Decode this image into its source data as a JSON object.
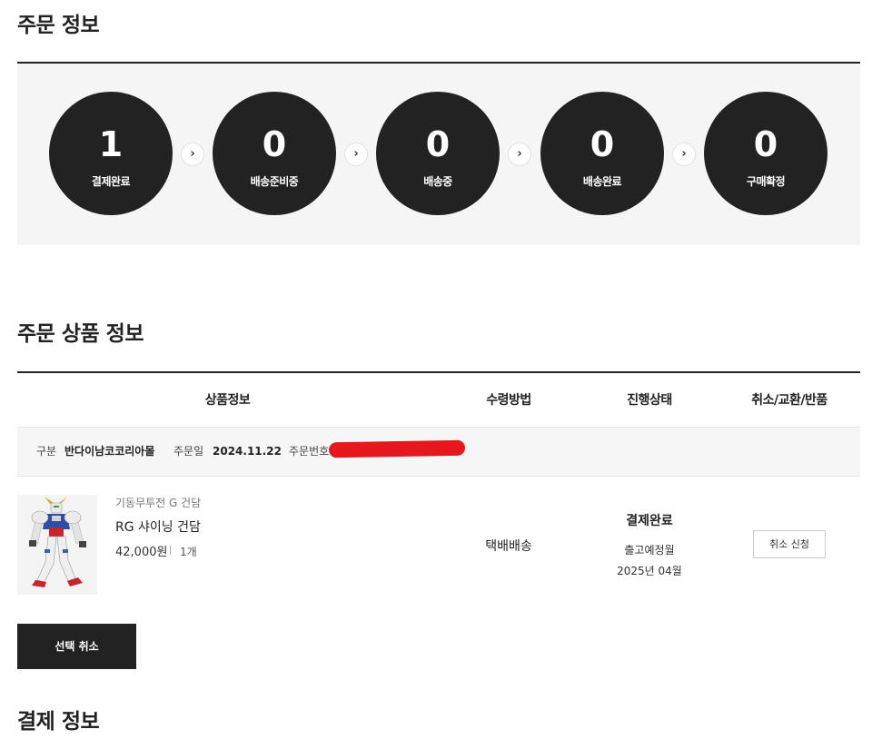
{
  "sections": {
    "order_info_title": "주문 정보",
    "order_items_title": "주문 상품 정보",
    "payment_info_title": "결제 정보"
  },
  "order_status": [
    {
      "count": "1",
      "label": "결제완료"
    },
    {
      "count": "0",
      "label": "배송준비중"
    },
    {
      "count": "0",
      "label": "배송중"
    },
    {
      "count": "0",
      "label": "배송완료"
    },
    {
      "count": "0",
      "label": "구매확정"
    }
  ],
  "arrow_glyph": "›",
  "table": {
    "headers": [
      "상품정보",
      "수령방법",
      "진행상태",
      "취소/교환/반품"
    ]
  },
  "order_meta": {
    "type_label": "구분",
    "type_value": "반다이남코코리아몰",
    "date_label": "주문일",
    "date_value": "2024.11.22",
    "number_label": "주문번호"
  },
  "item": {
    "brand": "기동무투전 G 건담",
    "name": "RG 샤이닝 건담",
    "price": "42,000원",
    "quantity": "1개",
    "delivery": "택배배송",
    "status": "결제완료",
    "ship_label": "출고예정월",
    "ship_month": "2025년 04월",
    "cancel_label": "취소 신청"
  },
  "select_cancel_label": "선택 취소",
  "colors": {
    "dark": "#222222",
    "panel_bg": "#f5f5f5",
    "redaction": "#e5191d"
  }
}
